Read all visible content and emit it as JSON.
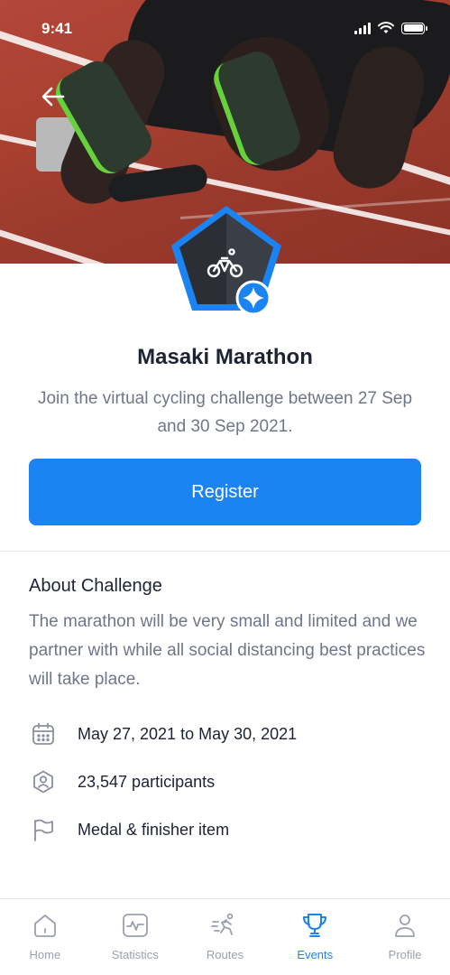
{
  "status_bar": {
    "time": "9:41"
  },
  "hero": {
    "back_icon": "arrow-left-icon"
  },
  "badge": {
    "icon": "bicycle-icon",
    "overlay_icon": "sparkle-icon",
    "accent": "#1c84f2"
  },
  "event": {
    "title": "Masaki Marathon",
    "subtitle": "Join the virtual cycling challenge between 27 Sep and 30 Sep 2021.",
    "register_label": "Register"
  },
  "about": {
    "title": "About Challenge",
    "text": "The marathon will be very small and limited and we partner with while all social distancing best practices will take place."
  },
  "info": [
    {
      "icon": "calendar-icon",
      "text": "May 27, 2021 to May 30, 2021"
    },
    {
      "icon": "participants-icon",
      "text": "23,547 participants"
    },
    {
      "icon": "flag-icon",
      "text": "Medal & finisher item"
    }
  ],
  "nav": [
    {
      "icon": "home-icon",
      "label": "Home"
    },
    {
      "icon": "statistics-icon",
      "label": "Statistics"
    },
    {
      "icon": "routes-icon",
      "label": "Routes"
    },
    {
      "icon": "trophy-icon",
      "label": "Events",
      "active": true
    },
    {
      "icon": "profile-icon",
      "label": "Profile"
    }
  ],
  "colors": {
    "primary": "#1c84f2",
    "text": "#1d2333",
    "muted": "#70768a",
    "nav_inactive": "#9aa0ae"
  }
}
